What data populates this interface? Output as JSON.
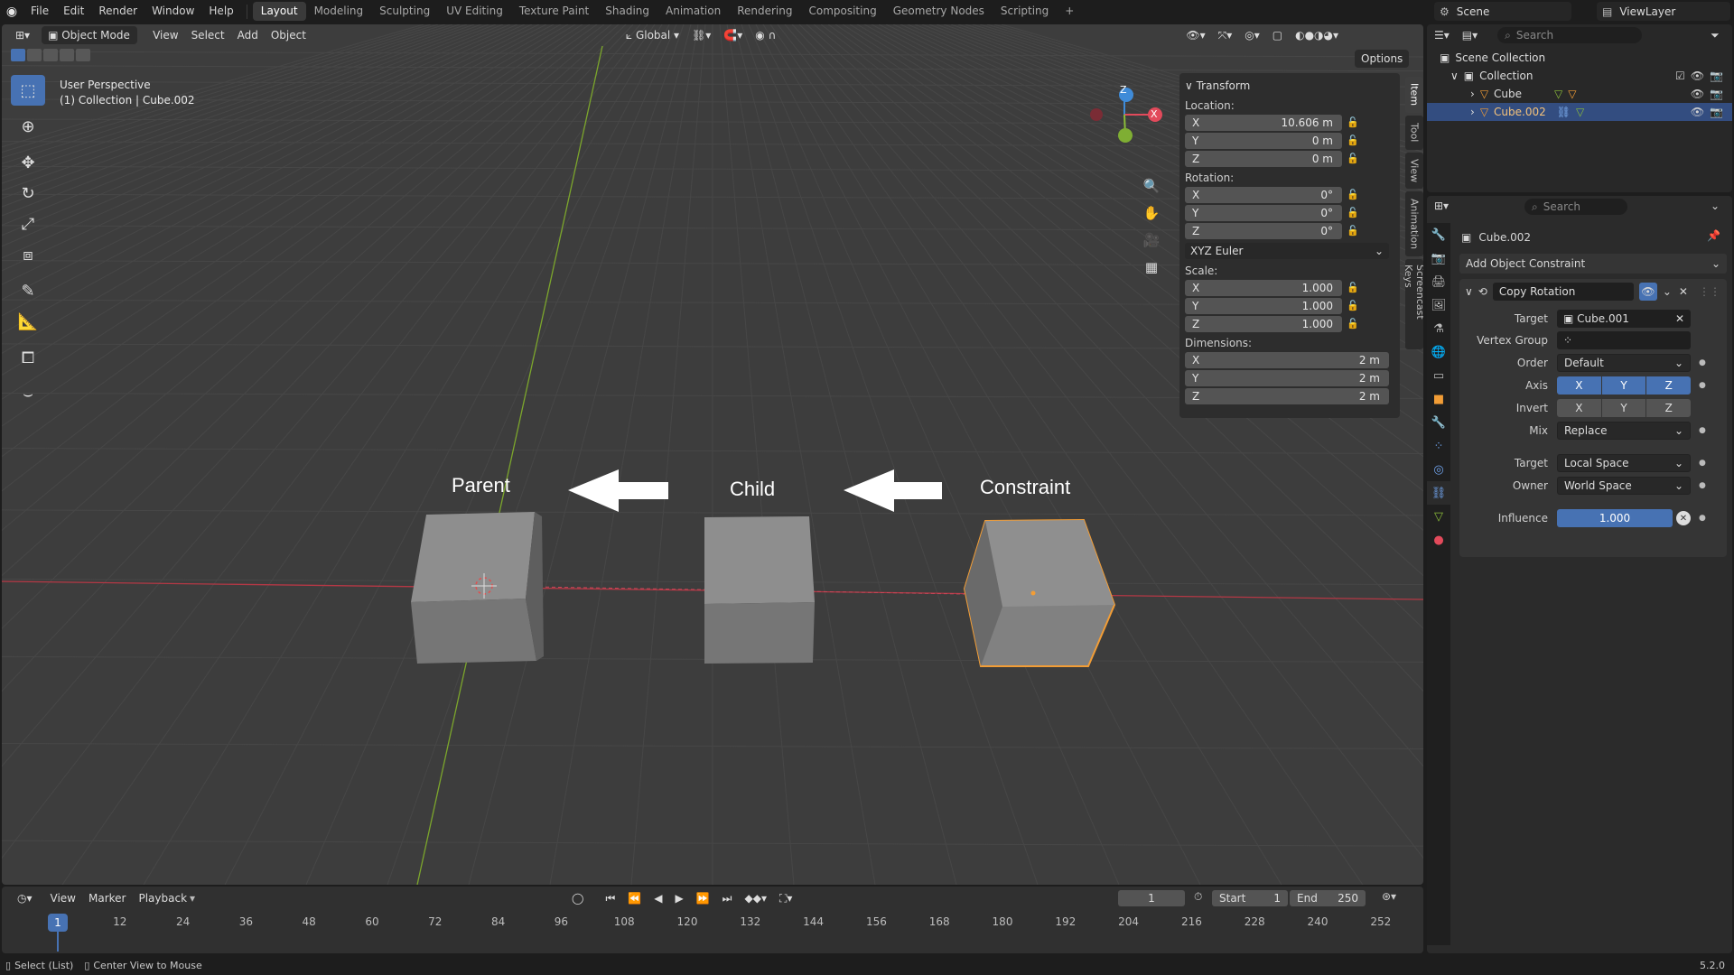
{
  "menu": [
    "File",
    "Edit",
    "Render",
    "Window",
    "Help"
  ],
  "workspaces": [
    "Layout",
    "Modeling",
    "Sculpting",
    "UV Editing",
    "Texture Paint",
    "Shading",
    "Animation",
    "Rendering",
    "Compositing",
    "Geometry Nodes",
    "Scripting"
  ],
  "active_workspace": "Layout",
  "scene_name": "Scene",
  "view_layer": "ViewLayer",
  "viewport": {
    "mode": "Object Mode",
    "menus": [
      "View",
      "Select",
      "Add",
      "Object"
    ],
    "orientation": "Global",
    "options_label": "Options",
    "perspective": "User Perspective",
    "collection_info": "(1) Collection | Cube.002",
    "labels": {
      "parent": "Parent",
      "child": "Child",
      "constraint": "Constraint"
    },
    "gizmo": {
      "x": "X",
      "y": "Y",
      "z": "Z"
    },
    "side_tabs": [
      "Item",
      "Tool",
      "View",
      "Animation",
      "Screencast Keys"
    ]
  },
  "transform": {
    "title": "Transform",
    "location_label": "Location:",
    "location": {
      "x": "10.606 m",
      "y": "0 m",
      "z": "0 m"
    },
    "rotation_label": "Rotation:",
    "rotation": {
      "x": "0°",
      "y": "0°",
      "z": "0°"
    },
    "rotation_mode": "XYZ Euler",
    "scale_label": "Scale:",
    "scale": {
      "x": "1.000",
      "y": "1.000",
      "z": "1.000"
    },
    "dimensions_label": "Dimensions:",
    "dimensions": {
      "x": "2 m",
      "y": "2 m",
      "z": "2 m"
    },
    "axis": {
      "x": "X",
      "y": "Y",
      "z": "Z"
    }
  },
  "timeline": {
    "menus": [
      "View",
      "Marker",
      "Playback"
    ],
    "current_frame": "1",
    "start_label": "Start",
    "start": "1",
    "end_label": "End",
    "end": "250",
    "ticks": [
      "1",
      "12",
      "24",
      "36",
      "48",
      "60",
      "72",
      "84",
      "96",
      "108",
      "120",
      "132",
      "144",
      "156",
      "168",
      "180",
      "192",
      "204",
      "216",
      "228",
      "240",
      "252"
    ]
  },
  "status": {
    "left1": "Select (List)",
    "left2": "Center View to Mouse",
    "version": "5.2.0"
  },
  "outliner": {
    "search_placeholder": "Search",
    "scene_collection": "Scene Collection",
    "collection": "Collection",
    "items": [
      "Cube",
      "Cube.002"
    ]
  },
  "properties": {
    "search_placeholder": "Search",
    "object_name": "Cube.002",
    "add_constraint": "Add Object Constraint",
    "constraint_name": "Copy Rotation",
    "target_label": "Target",
    "target_value": "Cube.001",
    "vertex_group_label": "Vertex Group",
    "order_label": "Order",
    "order_value": "Default",
    "axis_label": "Axis",
    "invert_label": "Invert",
    "axes": [
      "X",
      "Y",
      "Z"
    ],
    "mix_label": "Mix",
    "mix_value": "Replace",
    "target_space_label": "Target",
    "target_space": "Local Space",
    "owner_space_label": "Owner",
    "owner_space": "World Space",
    "influence_label": "Influence",
    "influence_value": "1.000"
  },
  "colors": {
    "accent": "#4772b3",
    "selected_outline": "#f29d36",
    "x_axis": "#e24a5b",
    "y_axis": "#8bbd3a",
    "z_axis": "#3f8bd8"
  }
}
